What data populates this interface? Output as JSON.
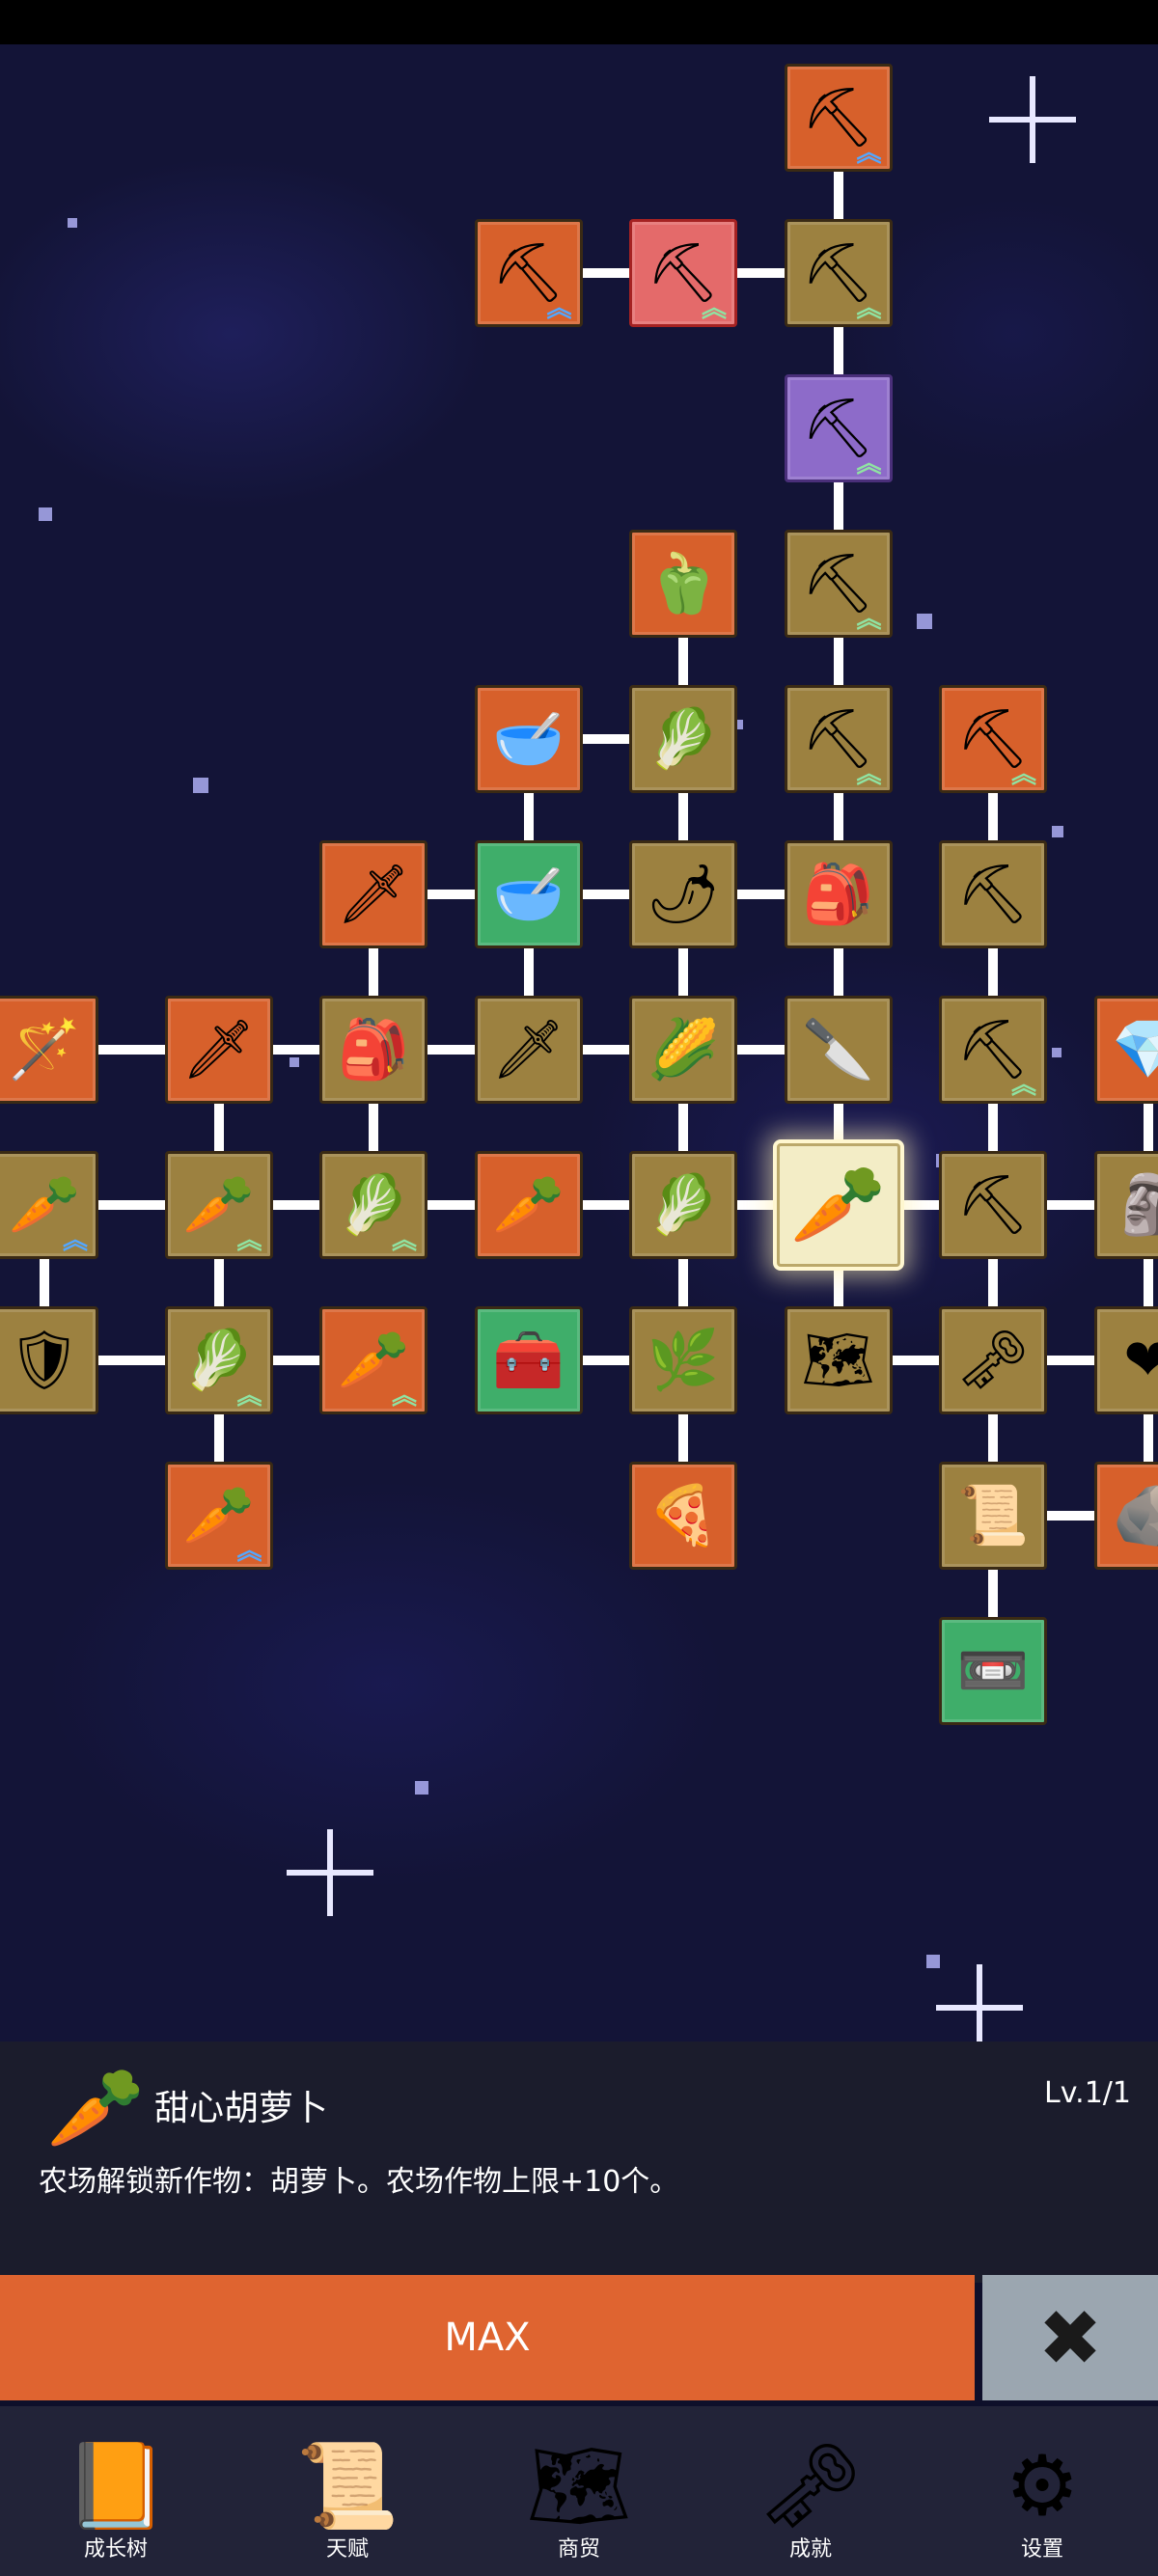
{
  "info": {
    "title": "甜心胡萝卜",
    "level": "Lv.1/1",
    "description": "农场解锁新作物：胡萝卜。农场作物上限+10个。",
    "icon": "carrot-icon"
  },
  "actions": {
    "max_label": "MAX",
    "close_icon": "close-icon"
  },
  "nav": {
    "items": [
      {
        "label": "成长树",
        "icon": "book-icon"
      },
      {
        "label": "天赋",
        "icon": "scroll-icon"
      },
      {
        "label": "商贸",
        "icon": "map-icon"
      },
      {
        "label": "成就",
        "icon": "key-icon"
      },
      {
        "label": "设置",
        "icon": "gear-icon"
      }
    ]
  },
  "tree": {
    "selected_node": "sweet-carrot",
    "nodes": [
      {
        "id": "shovel-top",
        "icon": "shovel-icon",
        "color": "orange",
        "chevron": "blue"
      },
      {
        "id": "shovel-a",
        "icon": "shovel-icon",
        "color": "orange",
        "chevron": "blue"
      },
      {
        "id": "shovel-b",
        "icon": "shovel-icon",
        "color": "pink",
        "chevron": "green"
      },
      {
        "id": "shovel-c",
        "icon": "shovel-icon",
        "color": "gold",
        "chevron": "green"
      },
      {
        "id": "shovel-d",
        "icon": "shovel-icon",
        "color": "purple",
        "chevron": "green"
      },
      {
        "id": "pepper",
        "icon": "pepper-icon",
        "color": "orange",
        "chevron": ""
      },
      {
        "id": "shovel-e",
        "icon": "shovel-icon",
        "color": "gold",
        "chevron": "green"
      },
      {
        "id": "soup-bowl",
        "icon": "bowl-icon",
        "color": "orange",
        "chevron": ""
      },
      {
        "id": "radish",
        "icon": "radish-icon",
        "color": "gold",
        "chevron": ""
      },
      {
        "id": "shovel-f",
        "icon": "shovel-icon",
        "color": "gold",
        "chevron": "green"
      },
      {
        "id": "pickaxe-a",
        "icon": "pickaxe-icon",
        "color": "orange",
        "chevron": "green"
      },
      {
        "id": "golden-sword",
        "icon": "sword-icon",
        "color": "orange",
        "chevron": ""
      },
      {
        "id": "bowl",
        "icon": "bowl-icon",
        "color": "green",
        "chevron": ""
      },
      {
        "id": "chili",
        "icon": "chili-icon",
        "color": "gold",
        "chevron": ""
      },
      {
        "id": "backpack-a",
        "icon": "backpack-icon",
        "color": "gold",
        "chevron": ""
      },
      {
        "id": "pickaxe-b",
        "icon": "pickaxe-icon",
        "color": "gold",
        "chevron": ""
      },
      {
        "id": "staff",
        "icon": "staff-icon",
        "color": "orange",
        "chevron": ""
      },
      {
        "id": "sword-a",
        "icon": "sword-icon",
        "color": "orange",
        "chevron": ""
      },
      {
        "id": "backpack-b",
        "icon": "backpack-icon",
        "color": "gold",
        "chevron": ""
      },
      {
        "id": "sword-b",
        "icon": "sword-icon",
        "color": "gold",
        "chevron": ""
      },
      {
        "id": "corn",
        "icon": "corn-icon",
        "color": "gold",
        "chevron": ""
      },
      {
        "id": "dagger",
        "icon": "dagger-icon",
        "color": "gold",
        "chevron": ""
      },
      {
        "id": "pickaxe-c",
        "icon": "pickaxe-icon",
        "color": "gold",
        "chevron": "green"
      },
      {
        "id": "crystal",
        "icon": "crystal-icon",
        "color": "orange",
        "chevron": ""
      },
      {
        "id": "carrot-a",
        "icon": "carrot-icon",
        "color": "gold",
        "chevron": "blue"
      },
      {
        "id": "carrot-b",
        "icon": "carrot-icon",
        "color": "gold",
        "chevron": "green"
      },
      {
        "id": "cabbage-a",
        "icon": "cabbage-icon",
        "color": "gold",
        "chevron": "green"
      },
      {
        "id": "carrot-c",
        "icon": "carrot-icon",
        "color": "orange",
        "chevron": ""
      },
      {
        "id": "cabbage-b",
        "icon": "cabbage-icon",
        "color": "gold",
        "chevron": ""
      },
      {
        "id": "sweet-carrot",
        "icon": "carrot-icon",
        "color": "glow",
        "chevron": ""
      },
      {
        "id": "pickaxe-d",
        "icon": "pickaxe-icon",
        "color": "gold",
        "chevron": ""
      },
      {
        "id": "statue",
        "icon": "statue-icon",
        "color": "gold",
        "chevron": ""
      },
      {
        "id": "shield",
        "icon": "shield-icon",
        "color": "gold",
        "chevron": ""
      },
      {
        "id": "cabbage-c",
        "icon": "cabbage-icon",
        "color": "gold",
        "chevron": "green"
      },
      {
        "id": "carrot-d",
        "icon": "carrot-icon",
        "color": "orange",
        "chevron": "green"
      },
      {
        "id": "chest",
        "icon": "chest-icon",
        "color": "green",
        "chevron": ""
      },
      {
        "id": "leek",
        "icon": "leek-icon",
        "color": "gold",
        "chevron": ""
      },
      {
        "id": "map",
        "icon": "map-icon",
        "color": "gold",
        "chevron": ""
      },
      {
        "id": "gold-key",
        "icon": "key-icon",
        "color": "gold",
        "chevron": ""
      },
      {
        "id": "heart",
        "icon": "heart-icon",
        "color": "gold",
        "chevron": "green"
      },
      {
        "id": "carrot-e",
        "icon": "carrot-icon",
        "color": "orange",
        "chevron": "blue"
      },
      {
        "id": "pizza",
        "icon": "pizza-icon",
        "color": "orange",
        "chevron": ""
      },
      {
        "id": "scroll",
        "icon": "scroll-icon",
        "color": "gold",
        "chevron": ""
      },
      {
        "id": "stone",
        "icon": "stone-icon",
        "color": "orange",
        "chevron": ""
      },
      {
        "id": "tape",
        "icon": "cassette-icon",
        "color": "green",
        "chevron": ""
      }
    ]
  }
}
